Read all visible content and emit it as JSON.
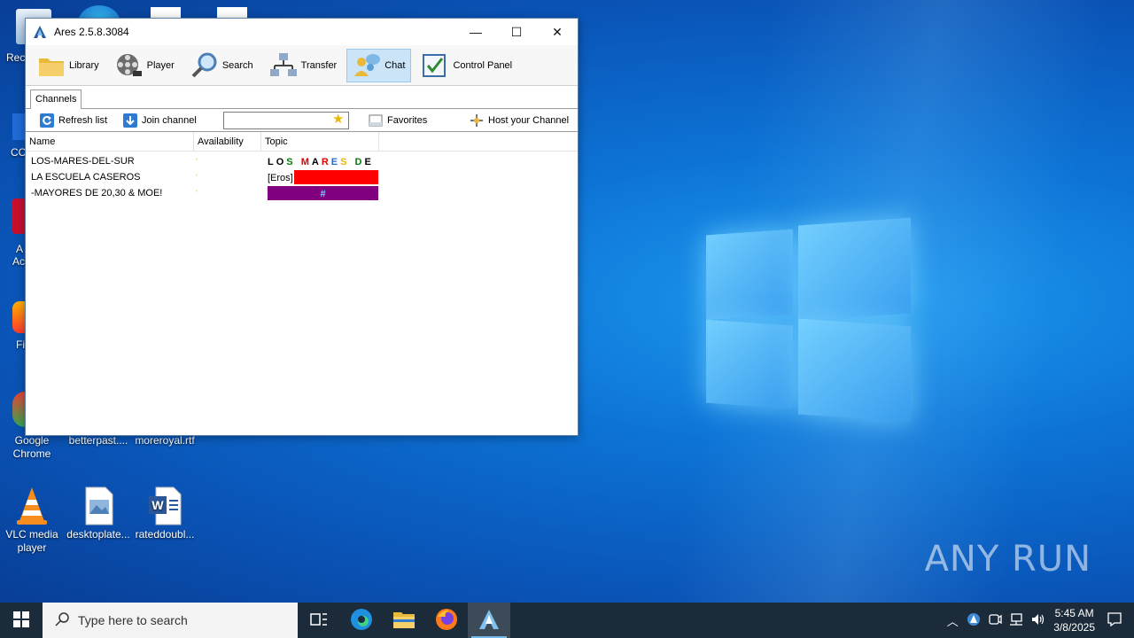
{
  "window": {
    "title": "Ares 2.5.8.3084",
    "controls": {
      "minimize": "—",
      "maximize": "☐",
      "close": "✕"
    }
  },
  "toolbar": {
    "items": [
      {
        "label": "Library",
        "icon": "library-folder-icon"
      },
      {
        "label": "Player",
        "icon": "film-reel-icon"
      },
      {
        "label": "Search",
        "icon": "magnifier-icon"
      },
      {
        "label": "Transfer",
        "icon": "transfer-network-icon"
      },
      {
        "label": "Chat",
        "icon": "chat-users-icon",
        "active": true
      },
      {
        "label": "Control Panel",
        "icon": "control-panel-icon"
      }
    ]
  },
  "tabs": {
    "channels": "Channels"
  },
  "actions": {
    "refresh": "Refresh list",
    "join": "Join channel",
    "search_value": "",
    "favorites": "Favorites",
    "host": "Host your Channel"
  },
  "table": {
    "columns": [
      "Name",
      "Availability",
      "Topic"
    ],
    "rows": [
      {
        "name": "LOS-MARES-DEL-SUR",
        "availability": "'",
        "topic": "LOS MARES DE"
      },
      {
        "name": "LA ESCUELA CASEROS",
        "availability": "'",
        "topic": "[Eros]"
      },
      {
        "name": "-MAYORES DE 20,30 & MOE!",
        "availability": "'",
        "topic": "#"
      }
    ]
  },
  "desktop": {
    "icons": [
      {
        "label": "Google Chrome"
      },
      {
        "label": "betterpast...."
      },
      {
        "label": "moreroyal.rtf"
      },
      {
        "label": "VLC media player"
      },
      {
        "label": "desktoplate..."
      },
      {
        "label": "rateddoubl..."
      }
    ],
    "left_edge_labels": [
      "Recy",
      "CC",
      "A",
      "Ac",
      "Fi"
    ],
    "watermark": "ANY RUN"
  },
  "taskbar": {
    "search_placeholder": "Type here to search",
    "time": "5:45 AM",
    "date": "3/8/2025"
  },
  "colors": {
    "accent": "#0d74d6",
    "chat_active_bg": "#cce4f7",
    "topic_red": "#ff0000",
    "topic_purple": "#800080",
    "taskbar": "#1c2b3a"
  }
}
